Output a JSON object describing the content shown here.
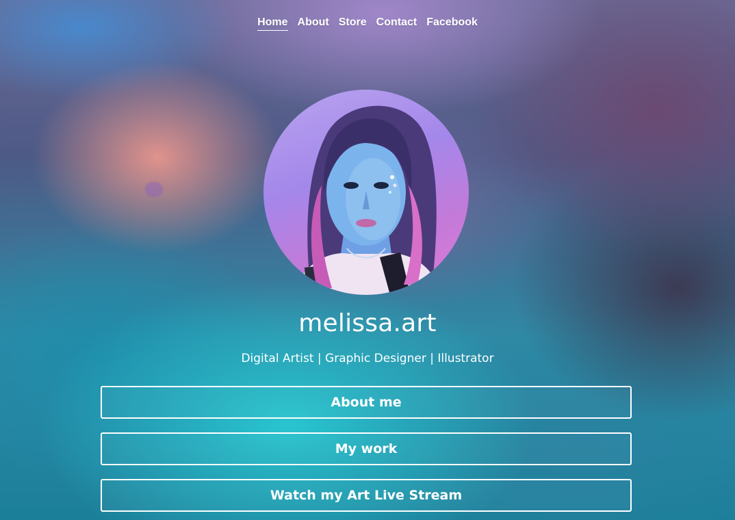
{
  "nav": {
    "items": [
      {
        "label": "Home",
        "active": true
      },
      {
        "label": "About"
      },
      {
        "label": "Store"
      },
      {
        "label": "Contact"
      },
      {
        "label": "Facebook"
      }
    ]
  },
  "profile": {
    "name": "melissa.art",
    "tagline": "Digital Artist | Graphic Designer | Illustrator"
  },
  "links": [
    {
      "label": "About me"
    },
    {
      "label": "My work"
    },
    {
      "label": "Watch my Art Live Stream"
    }
  ],
  "colors": {
    "text": "#ffffff",
    "button_border": "#ffffff"
  }
}
